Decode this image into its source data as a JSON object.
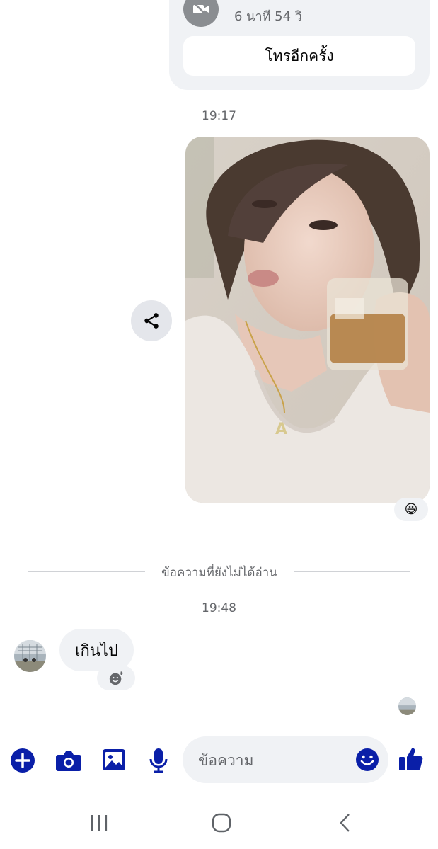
{
  "call": {
    "duration": "6 นาที 54 วิ",
    "callback_label": "โทรอีกครั้ง",
    "icon": "video-camera-off-icon"
  },
  "thread": {
    "time_1": "19:17",
    "time_2": "19:48",
    "unread_divider": "ข้อความที่ยังไม่ได้อ่าน",
    "photo_reaction": "😆",
    "incoming_message": "เกินไป"
  },
  "composer": {
    "placeholder": "ข้อความ",
    "icons": [
      "plus-icon",
      "camera-icon",
      "image-icon",
      "microphone-icon",
      "emoji-icon",
      "thumbs-up-icon"
    ]
  },
  "colors": {
    "accent": "#0a1fa8",
    "bubble_bg": "#f0f2f5",
    "secondary_text": "#65676b"
  },
  "nav": {
    "icons": [
      "recent-apps-icon",
      "home-icon",
      "back-icon"
    ]
  }
}
